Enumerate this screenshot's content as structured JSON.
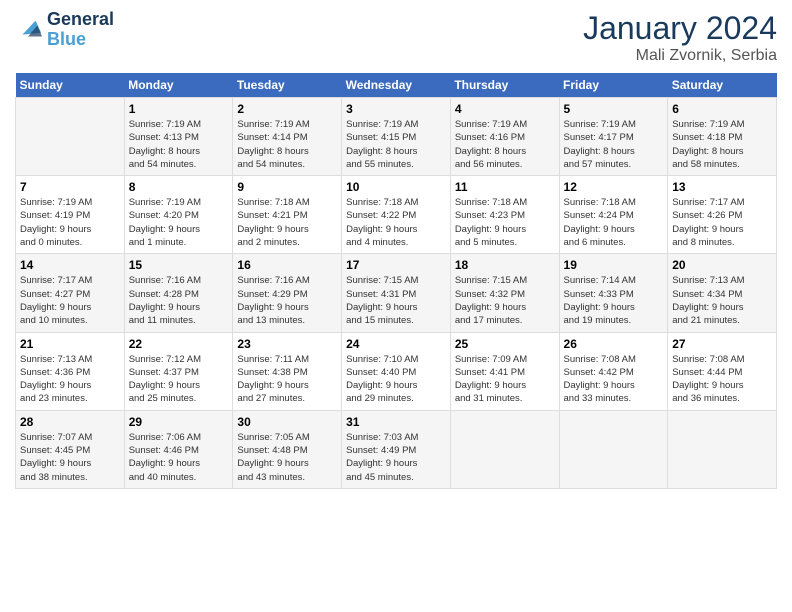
{
  "header": {
    "logo_line1": "General",
    "logo_line2": "Blue",
    "month": "January 2024",
    "location": "Mali Zvornik, Serbia"
  },
  "weekdays": [
    "Sunday",
    "Monday",
    "Tuesday",
    "Wednesday",
    "Thursday",
    "Friday",
    "Saturday"
  ],
  "weeks": [
    [
      {
        "day": "",
        "info": ""
      },
      {
        "day": "1",
        "info": "Sunrise: 7:19 AM\nSunset: 4:13 PM\nDaylight: 8 hours\nand 54 minutes."
      },
      {
        "day": "2",
        "info": "Sunrise: 7:19 AM\nSunset: 4:14 PM\nDaylight: 8 hours\nand 54 minutes."
      },
      {
        "day": "3",
        "info": "Sunrise: 7:19 AM\nSunset: 4:15 PM\nDaylight: 8 hours\nand 55 minutes."
      },
      {
        "day": "4",
        "info": "Sunrise: 7:19 AM\nSunset: 4:16 PM\nDaylight: 8 hours\nand 56 minutes."
      },
      {
        "day": "5",
        "info": "Sunrise: 7:19 AM\nSunset: 4:17 PM\nDaylight: 8 hours\nand 57 minutes."
      },
      {
        "day": "6",
        "info": "Sunrise: 7:19 AM\nSunset: 4:18 PM\nDaylight: 8 hours\nand 58 minutes."
      }
    ],
    [
      {
        "day": "7",
        "info": "Sunrise: 7:19 AM\nSunset: 4:19 PM\nDaylight: 9 hours\nand 0 minutes."
      },
      {
        "day": "8",
        "info": "Sunrise: 7:19 AM\nSunset: 4:20 PM\nDaylight: 9 hours\nand 1 minute."
      },
      {
        "day": "9",
        "info": "Sunrise: 7:18 AM\nSunset: 4:21 PM\nDaylight: 9 hours\nand 2 minutes."
      },
      {
        "day": "10",
        "info": "Sunrise: 7:18 AM\nSunset: 4:22 PM\nDaylight: 9 hours\nand 4 minutes."
      },
      {
        "day": "11",
        "info": "Sunrise: 7:18 AM\nSunset: 4:23 PM\nDaylight: 9 hours\nand 5 minutes."
      },
      {
        "day": "12",
        "info": "Sunrise: 7:18 AM\nSunset: 4:24 PM\nDaylight: 9 hours\nand 6 minutes."
      },
      {
        "day": "13",
        "info": "Sunrise: 7:17 AM\nSunset: 4:26 PM\nDaylight: 9 hours\nand 8 minutes."
      }
    ],
    [
      {
        "day": "14",
        "info": "Sunrise: 7:17 AM\nSunset: 4:27 PM\nDaylight: 9 hours\nand 10 minutes."
      },
      {
        "day": "15",
        "info": "Sunrise: 7:16 AM\nSunset: 4:28 PM\nDaylight: 9 hours\nand 11 minutes."
      },
      {
        "day": "16",
        "info": "Sunrise: 7:16 AM\nSunset: 4:29 PM\nDaylight: 9 hours\nand 13 minutes."
      },
      {
        "day": "17",
        "info": "Sunrise: 7:15 AM\nSunset: 4:31 PM\nDaylight: 9 hours\nand 15 minutes."
      },
      {
        "day": "18",
        "info": "Sunrise: 7:15 AM\nSunset: 4:32 PM\nDaylight: 9 hours\nand 17 minutes."
      },
      {
        "day": "19",
        "info": "Sunrise: 7:14 AM\nSunset: 4:33 PM\nDaylight: 9 hours\nand 19 minutes."
      },
      {
        "day": "20",
        "info": "Sunrise: 7:13 AM\nSunset: 4:34 PM\nDaylight: 9 hours\nand 21 minutes."
      }
    ],
    [
      {
        "day": "21",
        "info": "Sunrise: 7:13 AM\nSunset: 4:36 PM\nDaylight: 9 hours\nand 23 minutes."
      },
      {
        "day": "22",
        "info": "Sunrise: 7:12 AM\nSunset: 4:37 PM\nDaylight: 9 hours\nand 25 minutes."
      },
      {
        "day": "23",
        "info": "Sunrise: 7:11 AM\nSunset: 4:38 PM\nDaylight: 9 hours\nand 27 minutes."
      },
      {
        "day": "24",
        "info": "Sunrise: 7:10 AM\nSunset: 4:40 PM\nDaylight: 9 hours\nand 29 minutes."
      },
      {
        "day": "25",
        "info": "Sunrise: 7:09 AM\nSunset: 4:41 PM\nDaylight: 9 hours\nand 31 minutes."
      },
      {
        "day": "26",
        "info": "Sunrise: 7:08 AM\nSunset: 4:42 PM\nDaylight: 9 hours\nand 33 minutes."
      },
      {
        "day": "27",
        "info": "Sunrise: 7:08 AM\nSunset: 4:44 PM\nDaylight: 9 hours\nand 36 minutes."
      }
    ],
    [
      {
        "day": "28",
        "info": "Sunrise: 7:07 AM\nSunset: 4:45 PM\nDaylight: 9 hours\nand 38 minutes."
      },
      {
        "day": "29",
        "info": "Sunrise: 7:06 AM\nSunset: 4:46 PM\nDaylight: 9 hours\nand 40 minutes."
      },
      {
        "day": "30",
        "info": "Sunrise: 7:05 AM\nSunset: 4:48 PM\nDaylight: 9 hours\nand 43 minutes."
      },
      {
        "day": "31",
        "info": "Sunrise: 7:03 AM\nSunset: 4:49 PM\nDaylight: 9 hours\nand 45 minutes."
      },
      {
        "day": "",
        "info": ""
      },
      {
        "day": "",
        "info": ""
      },
      {
        "day": "",
        "info": ""
      }
    ]
  ]
}
